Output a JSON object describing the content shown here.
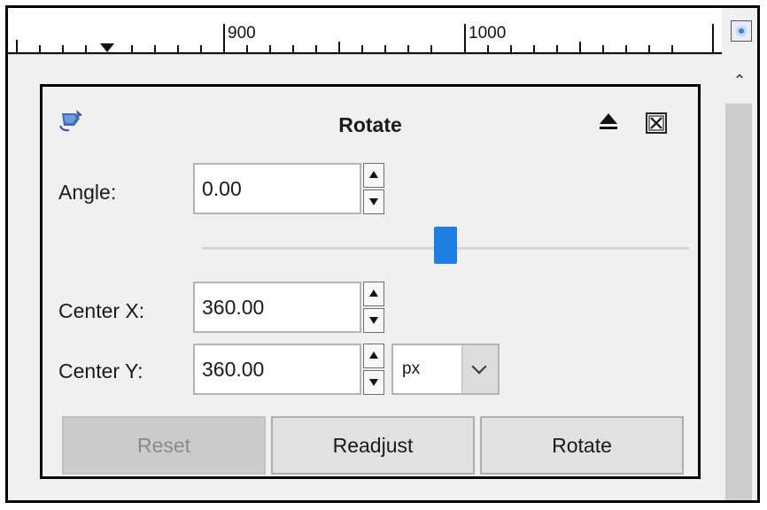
{
  "ruler": {
    "labels": [
      "900",
      "1000"
    ]
  },
  "dialog": {
    "title": "Rotate",
    "icons": {
      "tool": "rotate-tool-icon",
      "detach": "detach-icon",
      "close": "close-icon"
    },
    "angle": {
      "label": "Angle:",
      "value": "0.00",
      "slider_fraction": 0.5
    },
    "center_x": {
      "label": "Center X:",
      "value": "360.00"
    },
    "center_y": {
      "label": "Center Y:",
      "value": "360.00"
    },
    "unit": {
      "selected": "px"
    },
    "buttons": {
      "reset": "Reset",
      "readjust": "Readjust",
      "rotate": "Rotate"
    }
  },
  "colors": {
    "slider_thumb": "#1e7fe0",
    "panel_bg": "#f0f0f0"
  }
}
